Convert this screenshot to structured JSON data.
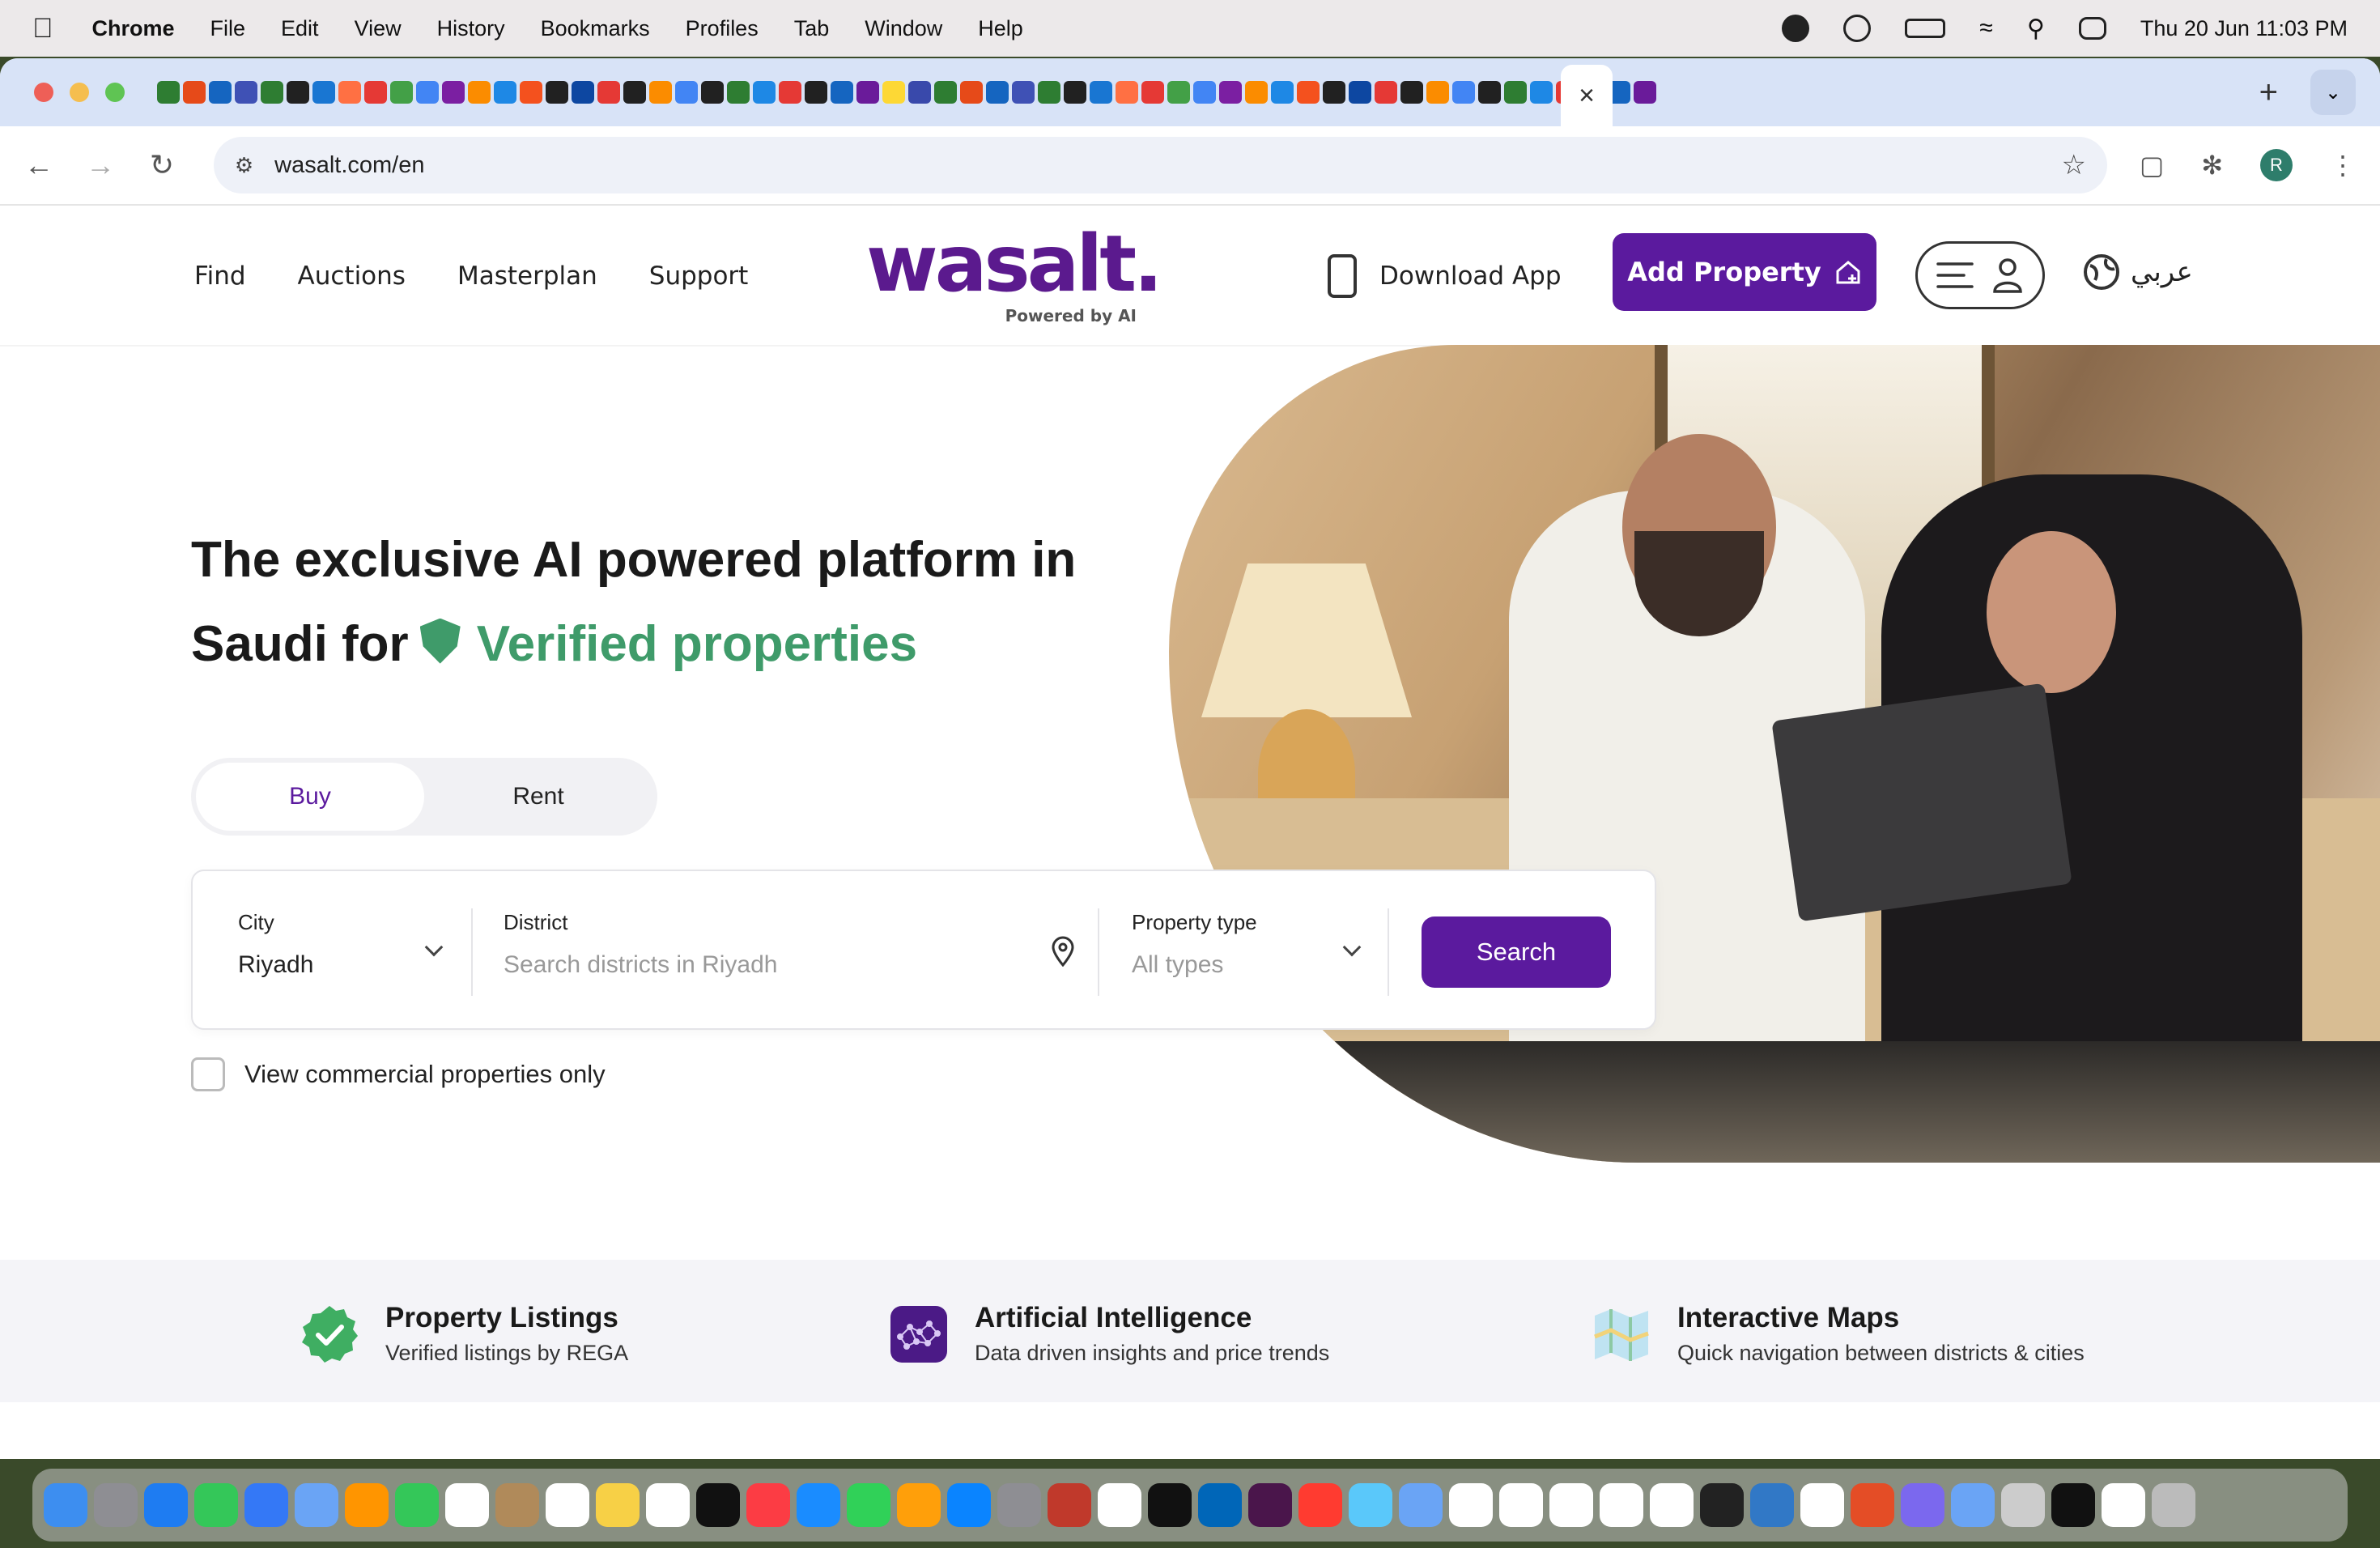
{
  "menubar": {
    "app": "Chrome",
    "items": [
      "File",
      "Edit",
      "View",
      "History",
      "Bookmarks",
      "Profiles",
      "Tab",
      "Window",
      "Help"
    ],
    "datetime": "Thu 20 Jun  11:03 PM"
  },
  "browser": {
    "url": "wasalt.com/en",
    "profile_initial": "R",
    "close_tab_glyph": "×",
    "new_tab_glyph": "+"
  },
  "nav": {
    "links": [
      "Find",
      "Auctions",
      "Masterplan",
      "Support"
    ],
    "logo": "wasalt.",
    "logo_sub": "Powered by AI",
    "download_app": "Download App",
    "add_property": "Add Property",
    "language": "عربي"
  },
  "hero": {
    "headline_line1": "The exclusive AI powered platform in",
    "headline_line2_prefix": "Saudi for",
    "headline_highlight": "Verified properties",
    "tabs": [
      "Buy",
      "Rent"
    ],
    "active_tab": "Buy"
  },
  "search": {
    "city_label": "City",
    "city_value": "Riyadh",
    "district_label": "District",
    "district_placeholder": "Search districts in Riyadh",
    "type_label": "Property type",
    "type_placeholder": "All types",
    "button": "Search",
    "commercial_label": "View commercial properties only"
  },
  "features": [
    {
      "title": "Property Listings",
      "subtitle": "Verified listings by REGA",
      "icon": "verified-check-icon"
    },
    {
      "title": "Artificial Intelligence",
      "subtitle": "Data driven insights and price trends",
      "icon": "ai-network-icon"
    },
    {
      "title": "Interactive Maps",
      "subtitle": "Quick navigation between districts & cities",
      "icon": "map-icon"
    }
  ],
  "colors": {
    "brand": "#5b1a9e",
    "verified_green": "#3f9b6a",
    "tabstrip": "#d8e3f7"
  }
}
